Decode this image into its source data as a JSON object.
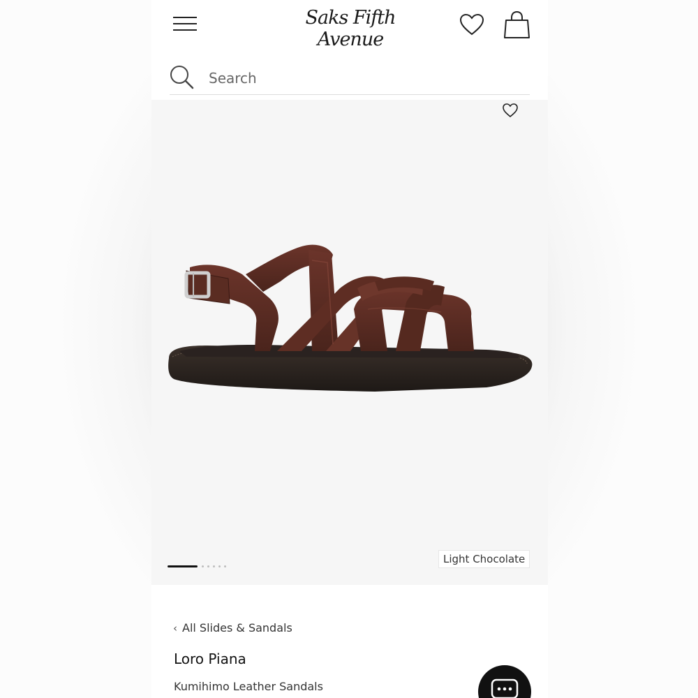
{
  "header": {
    "logo_text": "Saks Fifth Avenue",
    "icons": {
      "menu": "menu-icon",
      "wishlist": "heart-icon",
      "bag": "shopping-bag-icon"
    }
  },
  "search": {
    "placeholder": "Search",
    "value": "",
    "icon": "search-icon"
  },
  "gallery": {
    "color_label": "Light Chocolate",
    "image_count": 6,
    "active_index": 0,
    "wish_icon": "heart-icon"
  },
  "product": {
    "breadcrumb": "All Slides & Sandals",
    "brand": "Loro Piana",
    "name": "Kumihimo Leather Sandals"
  },
  "chat": {
    "icon": "chat-bubble-icon"
  },
  "colors": {
    "leather": "#5a2c22",
    "sole": "#2b2420",
    "accent": "#111111"
  }
}
